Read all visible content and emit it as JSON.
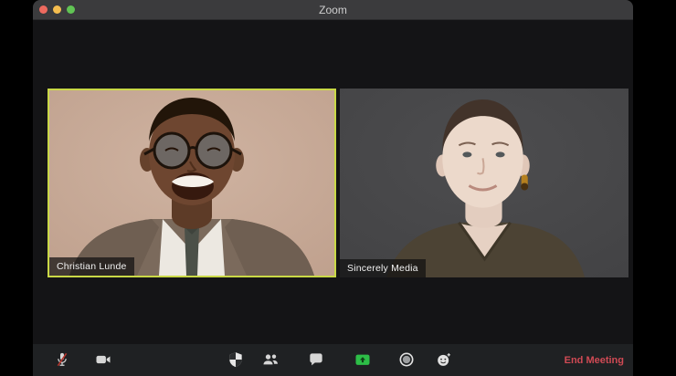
{
  "titlebar": {
    "title": "Zoom"
  },
  "participants": [
    {
      "name": "Christian Lunde",
      "active_speaker": true
    },
    {
      "name": "Sincerely Media",
      "active_speaker": false
    }
  ],
  "toolbar": {
    "buttons": [
      {
        "id": "mute",
        "icon": "microphone-muted-icon",
        "state": "muted"
      },
      {
        "id": "video",
        "icon": "video-camera-icon",
        "state": "on"
      },
      {
        "id": "security",
        "icon": "shield-icon"
      },
      {
        "id": "participants",
        "icon": "participants-icon"
      },
      {
        "id": "chat",
        "icon": "chat-bubble-icon"
      },
      {
        "id": "share-screen",
        "icon": "share-screen-icon"
      },
      {
        "id": "record",
        "icon": "record-icon"
      },
      {
        "id": "reactions",
        "icon": "reactions-icon"
      }
    ],
    "end_meeting_label": "End Meeting"
  },
  "colors": {
    "active_speaker_border": "#c9d846",
    "share_screen_green": "#2dbe47",
    "end_meeting_red": "#d04a54",
    "muted_slash_red": "#b5342c"
  }
}
